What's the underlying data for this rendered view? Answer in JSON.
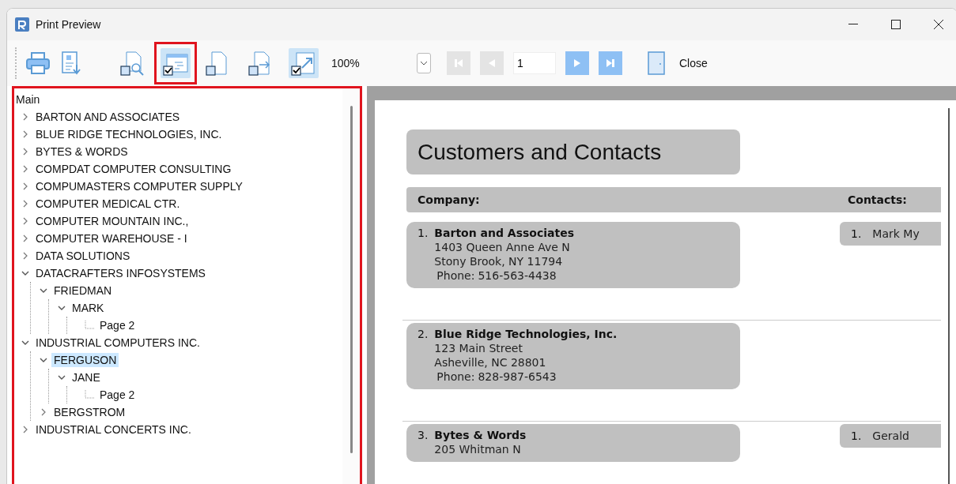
{
  "window": {
    "title": "Print Preview"
  },
  "toolbar": {
    "actions": [
      {
        "kind": "print"
      },
      {
        "kind": "export"
      }
    ],
    "toggles": [
      {
        "kind": "find",
        "checked": false,
        "annotated": false
      },
      {
        "kind": "outline",
        "checked": true,
        "annotated": true
      },
      {
        "kind": "page",
        "checked": false,
        "annotated": false
      },
      {
        "kind": "next-page",
        "checked": false,
        "annotated": false
      },
      {
        "kind": "fit",
        "checked": true,
        "annotated": false
      }
    ],
    "zoom": "100%",
    "nav": [
      {
        "kind": "first",
        "disabled": true
      },
      {
        "kind": "prev",
        "disabled": true
      }
    ],
    "page_field": "1",
    "nav_after": [
      {
        "kind": "next",
        "disabled": false
      },
      {
        "kind": "last",
        "disabled": false
      }
    ],
    "close_label": "Close"
  },
  "tree": {
    "annotated": true,
    "root": "Main",
    "items": [
      {
        "kind": "node",
        "label": "BARTON AND ASSOCIATES",
        "expanded": false,
        "selected": false
      },
      {
        "kind": "node",
        "label": "BLUE RIDGE TECHNOLOGIES, INC.",
        "expanded": false,
        "selected": false
      },
      {
        "kind": "node",
        "label": "BYTES & WORDS",
        "expanded": false,
        "selected": false
      },
      {
        "kind": "node",
        "label": "COMPDAT COMPUTER CONSULTING",
        "expanded": false,
        "selected": false
      },
      {
        "kind": "node",
        "label": "COMPUMASTERS COMPUTER SUPPLY",
        "expanded": false,
        "selected": false
      },
      {
        "kind": "node",
        "label": "COMPUTER MEDICAL CTR.",
        "expanded": false,
        "selected": false
      },
      {
        "kind": "node",
        "label": "COMPUTER MOUNTAIN INC.,",
        "expanded": false,
        "selected": false
      },
      {
        "kind": "node",
        "label": "COMPUTER WAREHOUSE - I",
        "expanded": false,
        "selected": false
      },
      {
        "kind": "node",
        "label": "DATA SOLUTIONS",
        "expanded": false,
        "selected": false
      },
      {
        "kind": "node",
        "label": "DATACRAFTERS INFOSYSTEMS",
        "expanded": true,
        "selected": false,
        "children": [
          {
            "kind": "node",
            "label": "FRIEDMAN",
            "expanded": true,
            "selected": false,
            "children": [
              {
                "kind": "node",
                "label": "MARK",
                "expanded": true,
                "selected": false,
                "children": [
                  {
                    "kind": "page",
                    "label": "Page 2",
                    "selected": false
                  }
                ]
              }
            ]
          }
        ]
      },
      {
        "kind": "node",
        "label": "INDUSTRIAL COMPUTERS INC.",
        "expanded": true,
        "selected": false,
        "children": [
          {
            "kind": "node",
            "label": "FERGUSON",
            "expanded": true,
            "selected": true,
            "children": [
              {
                "kind": "node",
                "label": "JANE",
                "expanded": true,
                "selected": false,
                "children": [
                  {
                    "kind": "page",
                    "label": "Page 2",
                    "selected": false
                  }
                ]
              }
            ]
          },
          {
            "kind": "node",
            "label": "BERGSTROM",
            "expanded": false,
            "selected": false
          }
        ]
      },
      {
        "kind": "node",
        "label": "INDUSTRIAL CONCERTS INC.",
        "expanded": false,
        "selected": false
      }
    ]
  },
  "report": {
    "title": "Customers and Contacts",
    "company_heading": "Company:",
    "contacts_heading": "Contacts:",
    "records": [
      {
        "number": "1.",
        "name": "Barton and Associates",
        "address": [
          "1403 Queen Anne Ave N",
          "Stony Brook, NY 11794"
        ],
        "phone_label": "Phone:",
        "phone": "516-563-4438",
        "contacts": [
          {
            "number": "1.",
            "name": "Mark My"
          }
        ]
      },
      {
        "number": "2.",
        "name": "Blue Ridge Technologies, Inc.",
        "address": [
          "123 Main Street",
          "Asheville, NC 28801"
        ],
        "phone_label": "Phone:",
        "phone": "828-987-6543"
      },
      {
        "number": "3.",
        "name": "Bytes & Words",
        "address": [
          "205 Whitman N"
        ],
        "contacts": [
          {
            "number": "1.",
            "name": "Gerald"
          }
        ]
      }
    ]
  }
}
